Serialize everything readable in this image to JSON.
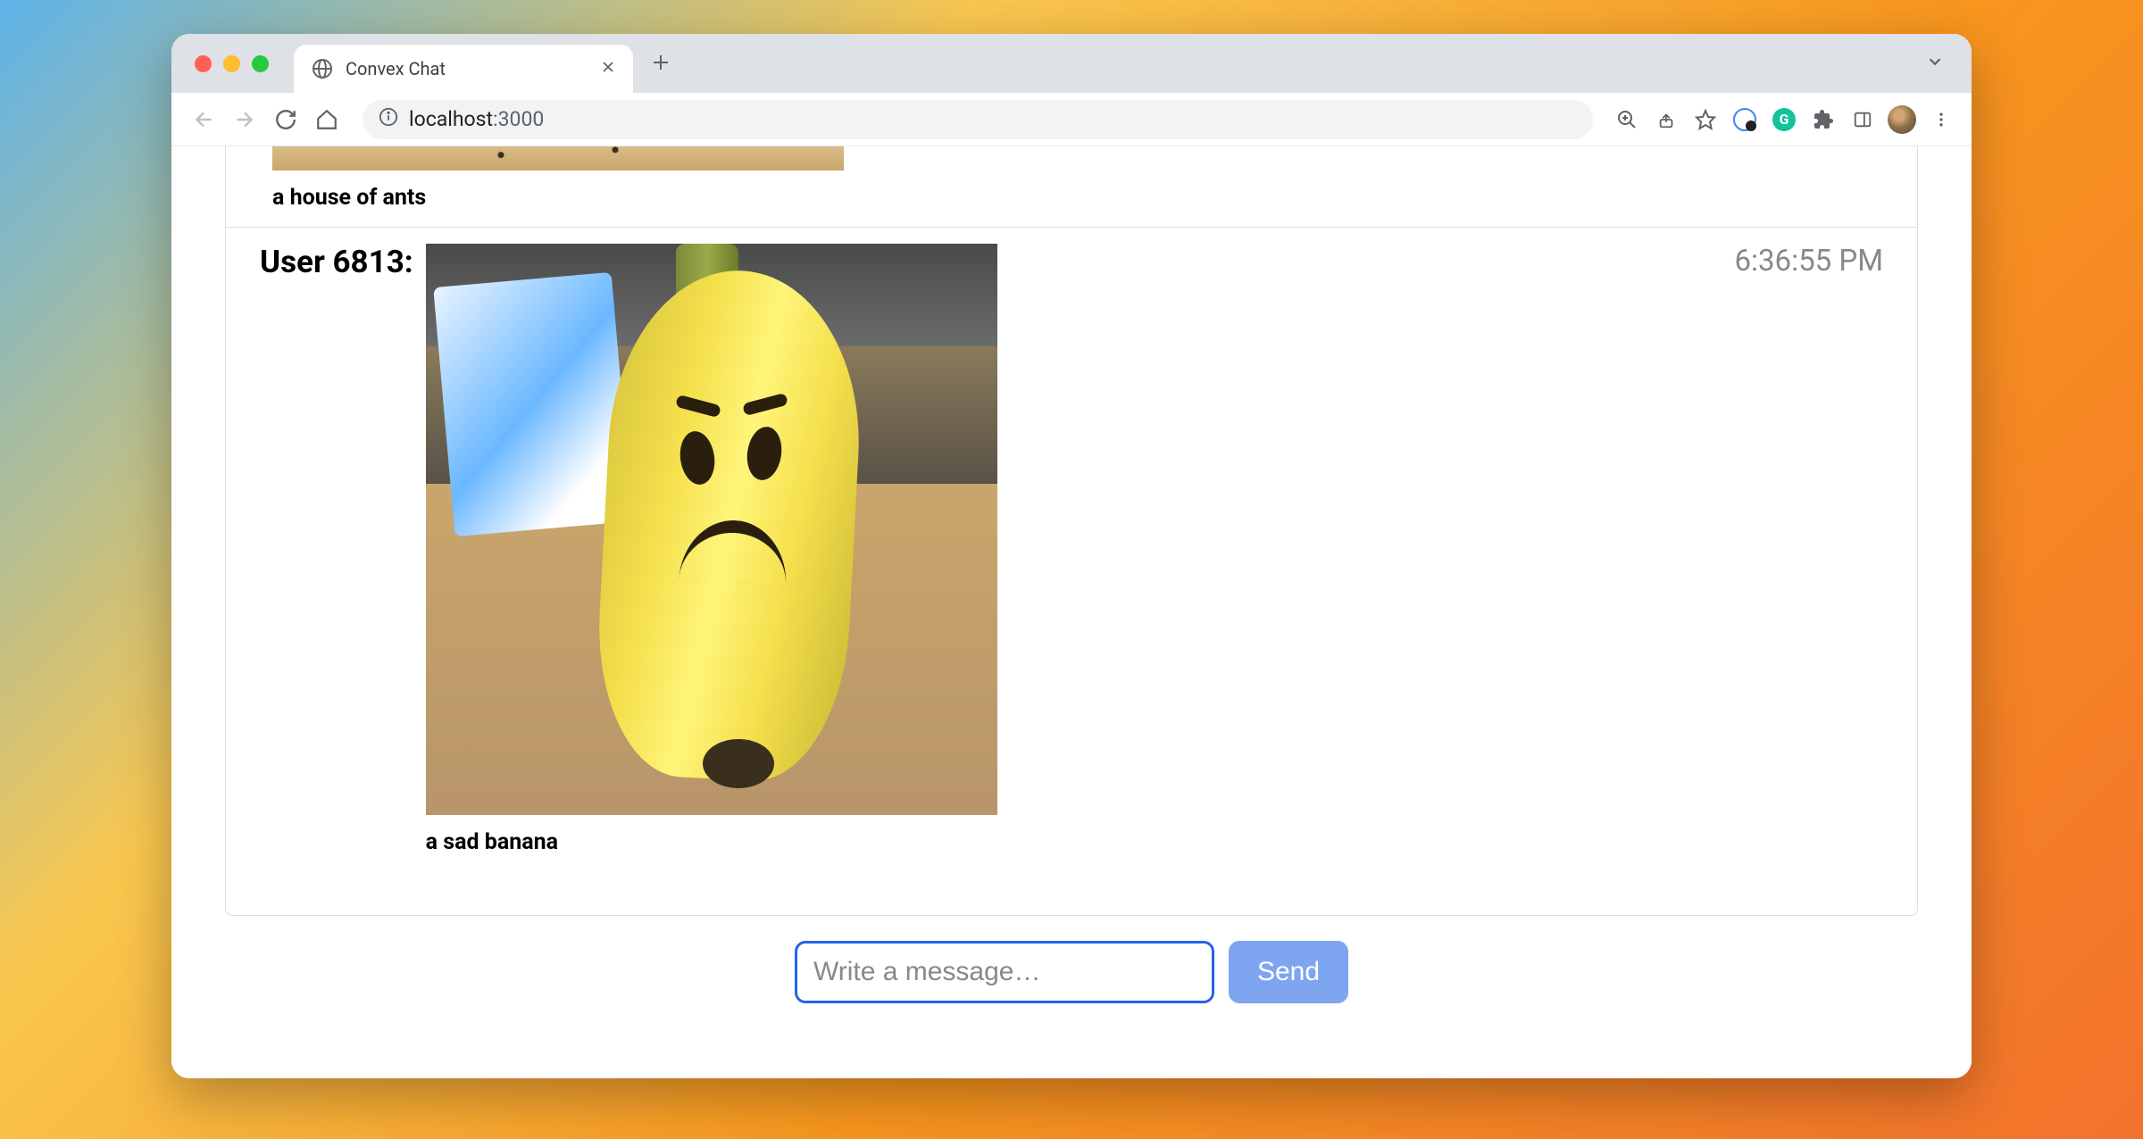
{
  "browser": {
    "tab_title": "Convex Chat",
    "url_host": "localhost",
    "url_port": ":3000"
  },
  "messages": [
    {
      "user": "",
      "caption": "a house of ants",
      "time": "",
      "image_alt": "a house of ants"
    },
    {
      "user": "User 6813:",
      "caption": "a sad banana",
      "time": "6:36:55 PM",
      "image_alt": "a sad banana"
    }
  ],
  "composer": {
    "placeholder": "Write a message…",
    "send_label": "Send"
  }
}
